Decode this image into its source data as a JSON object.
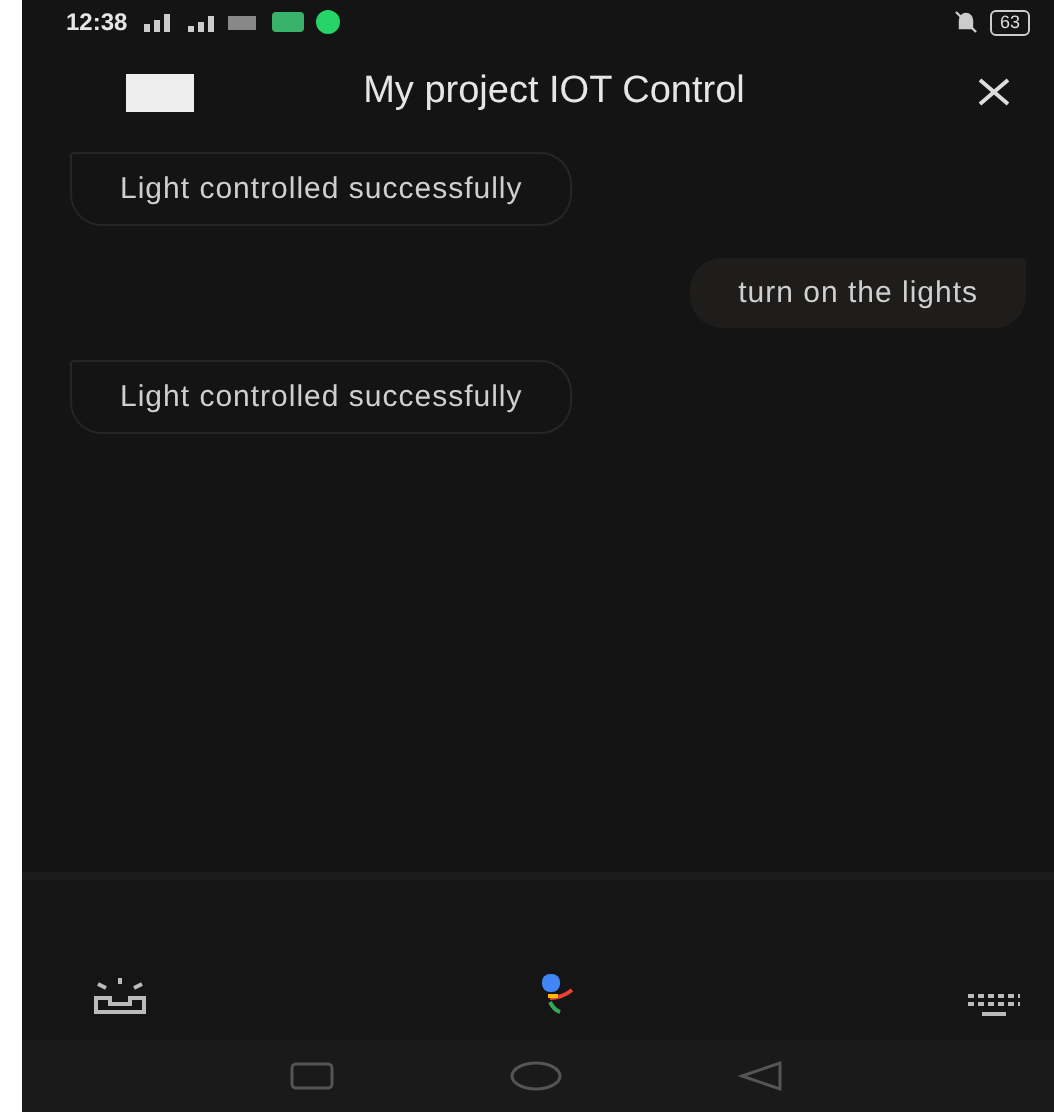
{
  "status_bar": {
    "time": "12:38",
    "battery": "63"
  },
  "header": {
    "title": "My project IOT Control"
  },
  "messages": [
    {
      "kind": "bot",
      "text": "Light controlled successfully"
    },
    {
      "kind": "user",
      "text": "turn on the lights"
    },
    {
      "kind": "bot",
      "text": "Light controlled successfully"
    }
  ]
}
